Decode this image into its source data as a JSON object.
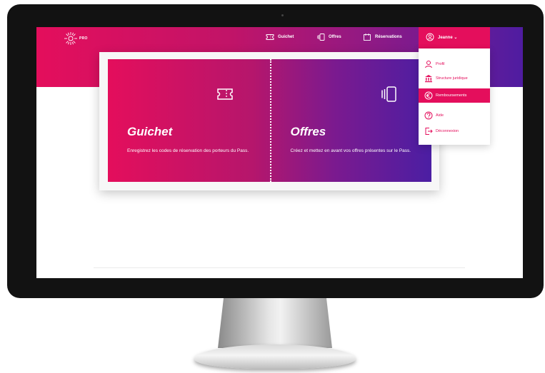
{
  "logo": {
    "text": "PRO"
  },
  "nav": {
    "guichet": "Guichet",
    "offres": "Offres",
    "reservations": "Réservations",
    "user": "Jeanne ⌄"
  },
  "cards": [
    {
      "title": "Guichet",
      "description": "Enregistrez les codes de réservation des porteurs du Pass."
    },
    {
      "title": "Offres",
      "description": "Créez et mettez en avant vos offres présentes sur le Pass."
    }
  ],
  "dropdown": {
    "items": [
      {
        "label": "Profil",
        "icon": "user-icon"
      },
      {
        "label": "Structure juridique",
        "icon": "bank-icon"
      },
      {
        "label": "Remboursements",
        "icon": "euro-icon",
        "active": true
      },
      {
        "label": "Aide",
        "icon": "help-icon"
      },
      {
        "label": "Déconnexion",
        "icon": "logout-icon"
      }
    ]
  },
  "colors": {
    "brand_pink": "#e40e5c",
    "brand_purple": "#4b1ea3"
  }
}
